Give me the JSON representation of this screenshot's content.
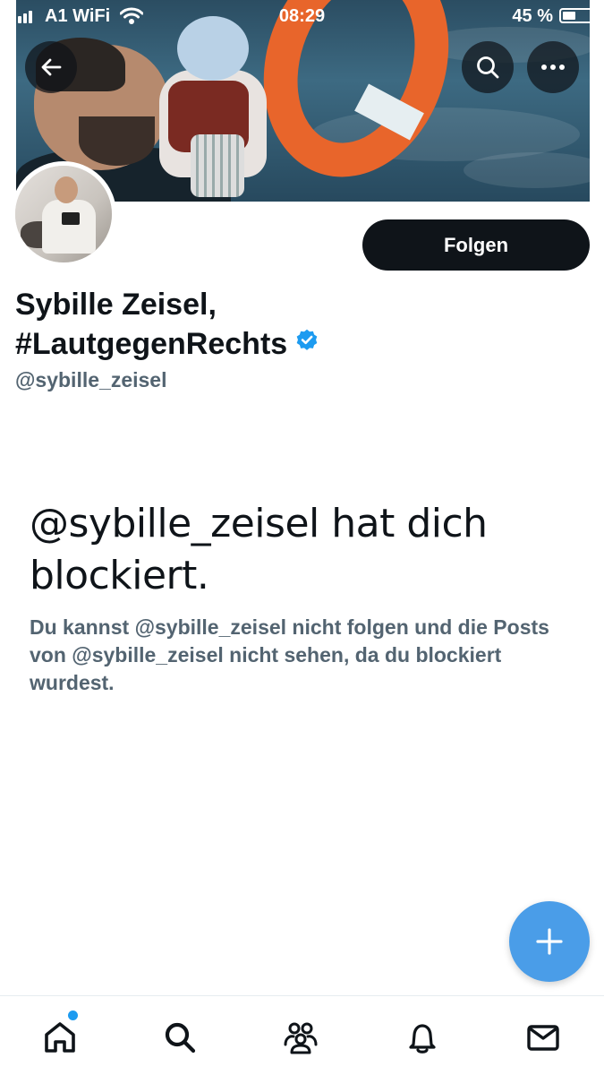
{
  "status_bar": {
    "carrier": "A1 WiFi",
    "time": "08:29",
    "battery": "45 %"
  },
  "profile": {
    "display_name_line1": "Sybille Zeisel,",
    "display_name_line2": "#LautgegenRechts",
    "handle": "@sybille_zeisel",
    "follow_label": "Folgen",
    "verified": true
  },
  "blocked": {
    "title": "@sybille_zeisel hat dich blockiert.",
    "description": "Du kannst @sybille_zeisel nicht folgen und die Posts von @sybille_zeisel nicht sehen, da du blockiert wurdest."
  },
  "nav": {
    "items": [
      "home-icon",
      "search-icon",
      "communities-icon",
      "notifications-icon",
      "messages-icon"
    ],
    "home_unread_dot": true
  },
  "colors": {
    "accent": "#1d9bf0",
    "fab": "#4a9de8",
    "text_primary": "#0f1419",
    "text_secondary": "#536471",
    "follow_bg": "#0f1419"
  }
}
